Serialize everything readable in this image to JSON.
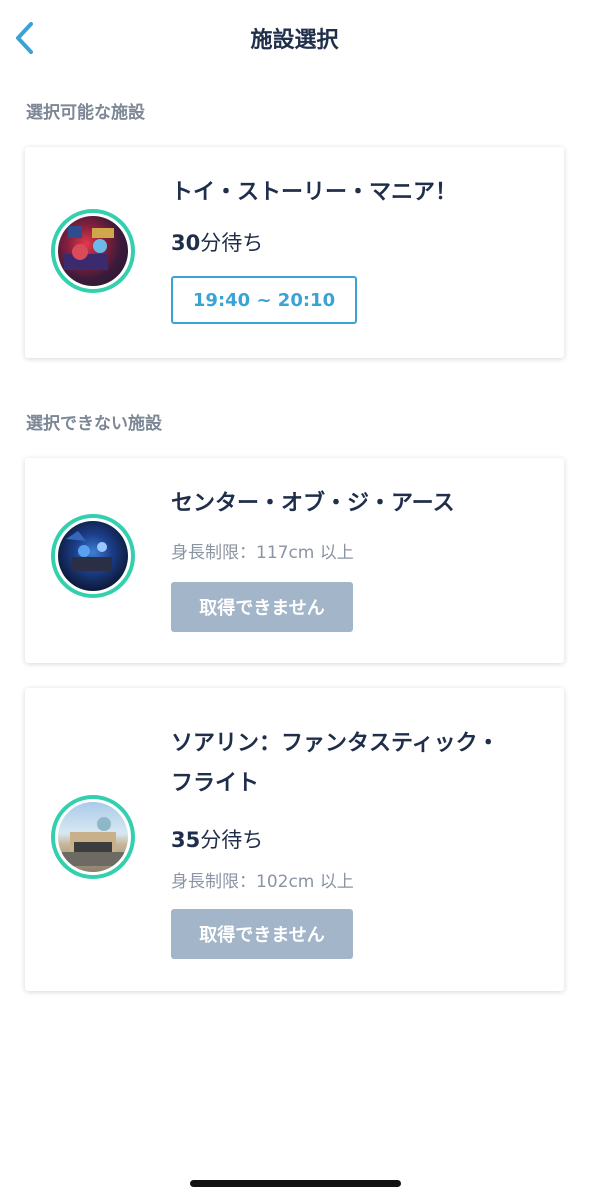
{
  "header": {
    "title": "施設選択",
    "back_icon": "chevron-left-icon",
    "accent_color": "#3aa3d6"
  },
  "sections": {
    "available_label": "選択可能な施設",
    "unavailable_label": "選択できない施設"
  },
  "available": [
    {
      "name": "トイ・ストーリー・マニア！",
      "wait_number": "30",
      "wait_unit": "分待ち",
      "time_slot": "19:40 ~ 20:10"
    }
  ],
  "unavailable": [
    {
      "name": "センター・オブ・ジ・アース",
      "height_limit": "身長制限：117cm 以上",
      "button_label": "取得できません"
    },
    {
      "name_line1": "ソアリン：ファンタスティック・",
      "name_line2": "フライト",
      "wait_number": "35",
      "wait_unit": "分待ち",
      "height_limit": "身長制限：102cm 以上",
      "button_label": "取得できません"
    }
  ],
  "colors": {
    "title": "#1f2e4a",
    "section": "#7d8796",
    "ring": "#33cfae",
    "disabled_button": "#a3b5c9"
  }
}
